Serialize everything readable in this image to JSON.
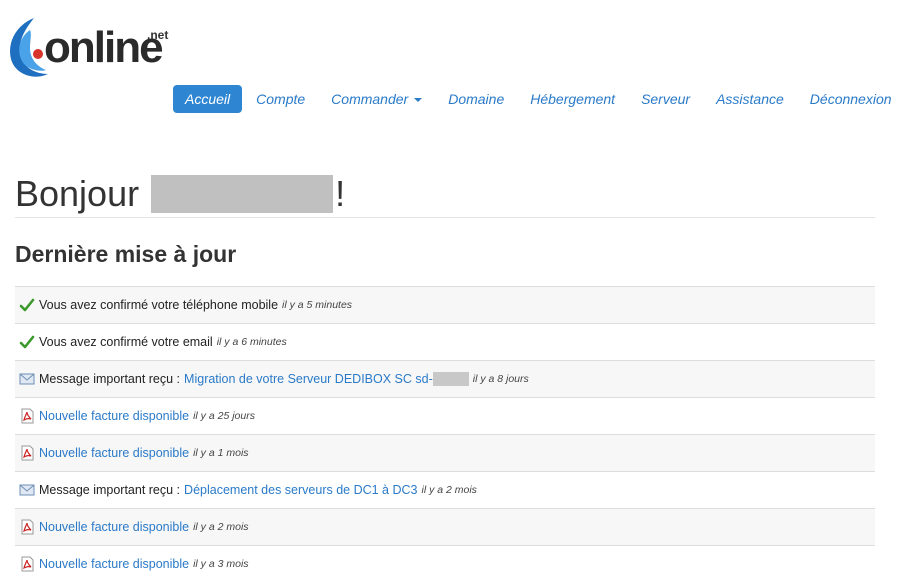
{
  "logo": {
    "text": "online",
    "suffix": ".net"
  },
  "nav": {
    "items": [
      {
        "label": "Accueil",
        "active": true
      },
      {
        "label": "Compte"
      },
      {
        "label": "Commander",
        "dropdown": true
      },
      {
        "label": "Domaine"
      },
      {
        "label": "Hébergement"
      },
      {
        "label": "Serveur"
      },
      {
        "label": "Assistance"
      },
      {
        "label": "Déconnexion"
      }
    ]
  },
  "greeting": {
    "prefix": "Bonjour",
    "suffix": "!"
  },
  "section": {
    "title": "Dernière mise à jour"
  },
  "activity": [
    {
      "icon": "check-icon",
      "text": "Vous avez confirmé votre téléphone mobile",
      "time": "il y a 5 minutes"
    },
    {
      "icon": "check-icon",
      "text": "Vous avez confirmé votre email",
      "time": "il y a 6 minutes"
    },
    {
      "icon": "mail-icon",
      "text": "Message important reçu :",
      "link": "Migration de votre Serveur DEDIBOX SC sd-",
      "time": "il y a 8 jours"
    },
    {
      "icon": "pdf-icon",
      "link": "Nouvelle facture disponible",
      "time": "il y a 25 jours"
    },
    {
      "icon": "pdf-icon",
      "link": "Nouvelle facture disponible",
      "time": "il y a 1 mois"
    },
    {
      "icon": "mail-icon",
      "text": "Message important reçu :",
      "link": "Déplacement des serveurs de DC1 à DC3",
      "time": "il y a 2 mois"
    },
    {
      "icon": "pdf-icon",
      "link": "Nouvelle facture disponible",
      "time": "il y a 2 mois"
    },
    {
      "icon": "pdf-icon",
      "link": "Nouvelle facture disponible",
      "time": "il y a 3 mois"
    }
  ],
  "colors": {
    "accent": "#2e86d3",
    "link": "#2a7ac8",
    "check": "#3a9a2a",
    "pdf": "#cc2222"
  }
}
